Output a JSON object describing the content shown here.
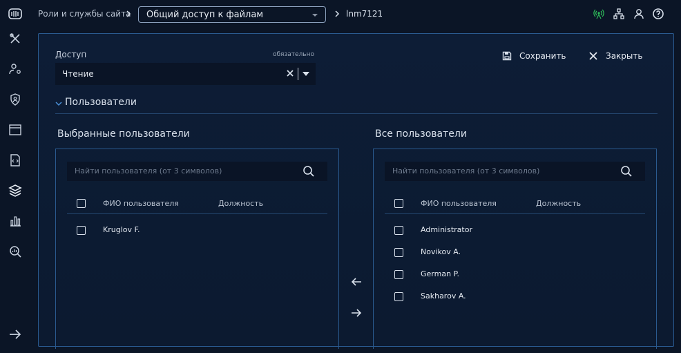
{
  "header": {
    "breadcrumb_root": "Роли и службы сайта",
    "breadcrumb_select": "Общий доступ к файлам",
    "breadcrumb_current": "lnm7121",
    "icons": [
      "app-logo-icon",
      "network-status-icon",
      "sitemap-icon",
      "user-icon",
      "help-icon"
    ]
  },
  "sidebar": {
    "items": [
      "tools-icon",
      "user-settings-icon",
      "shield-user-icon",
      "window-icon",
      "code-file-icon",
      "layers-icon",
      "bar-chart-icon",
      "search-analytics-icon",
      "expand-arrow-icon"
    ]
  },
  "form": {
    "access_label": "Доступ",
    "required_hint": "обязательно",
    "access_value": "Чтение",
    "save_label": "Сохранить",
    "close_label": "Закрыть"
  },
  "section": {
    "title": "Пользователи"
  },
  "selected_users": {
    "title": "Выбранные пользователи",
    "search_placeholder": "Найти пользователя (от 3 символов)",
    "columns": [
      "ФИО пользователя",
      "Должность"
    ],
    "rows": [
      {
        "name": "Kruglov F.",
        "position": ""
      }
    ]
  },
  "all_users": {
    "title": "Все пользователи",
    "search_placeholder": "Найти пользователя (от 3 символов)",
    "columns": [
      "ФИО пользователя",
      "Должность"
    ],
    "rows": [
      {
        "name": "Administrator",
        "position": ""
      },
      {
        "name": "Novikov A.",
        "position": ""
      },
      {
        "name": "German P.",
        "position": ""
      },
      {
        "name": "Sakharov A.",
        "position": ""
      }
    ]
  },
  "colors": {
    "background": "#0b1526",
    "panel_border": "#2a5a8f",
    "status_green": "#2fbf5a"
  }
}
